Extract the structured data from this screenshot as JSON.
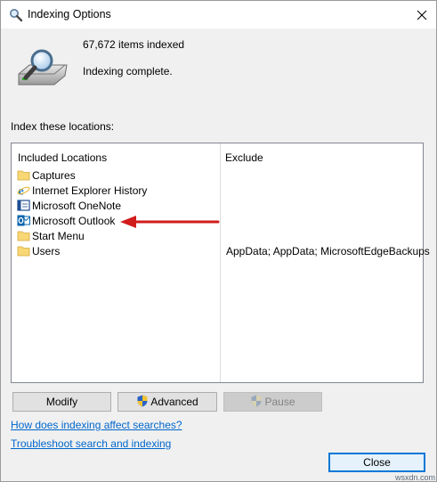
{
  "window": {
    "title": "Indexing Options",
    "icons": {
      "app": "indexing-options-icon",
      "close": "close-icon"
    }
  },
  "status": {
    "items_indexed": "67,672 items indexed",
    "state": "Indexing complete.",
    "icon": "magnifier-over-disk-icon"
  },
  "locations": {
    "section_label": "Index these locations:",
    "columns": {
      "included": "Included Locations",
      "exclude": "Exclude"
    },
    "rows": [
      {
        "name": "Captures",
        "icon": "folder-icon",
        "exclude": ""
      },
      {
        "name": "Internet Explorer History",
        "icon": "internet-explorer-icon",
        "exclude": ""
      },
      {
        "name": "Microsoft OneNote",
        "icon": "onenote-icon",
        "exclude": ""
      },
      {
        "name": "Microsoft Outlook",
        "icon": "outlook-icon",
        "exclude": ""
      },
      {
        "name": "Start Menu",
        "icon": "folder-icon",
        "exclude": ""
      },
      {
        "name": "Users",
        "icon": "folder-icon",
        "exclude": "AppData; AppData; MicrosoftEdgeBackups"
      }
    ],
    "annotation_color": "#d21b1b"
  },
  "buttons": {
    "modify": "Modify",
    "advanced": "Advanced",
    "pause": "Pause",
    "close": "Close"
  },
  "links": {
    "how_indexing": "How does indexing affect searches?",
    "troubleshoot": "Troubleshoot search and indexing"
  },
  "watermark": "wsxdn.com",
  "colors": {
    "link": "#0066cc",
    "default_button_border": "#0078d7"
  }
}
